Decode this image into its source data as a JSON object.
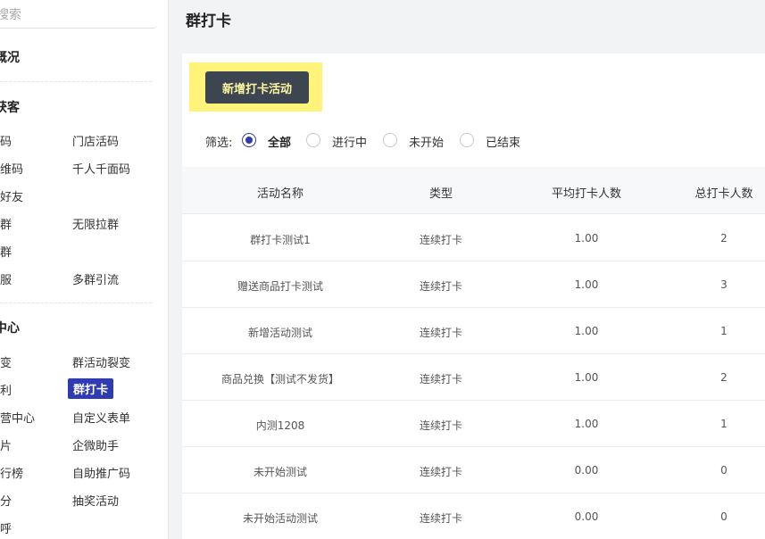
{
  "sidebar": {
    "search_placeholder": "搜索",
    "sections": [
      {
        "title": "概况"
      },
      {
        "title": "获客"
      },
      {
        "title": "中心"
      }
    ],
    "items": [
      {
        "label": "码"
      },
      {
        "label": "门店活码"
      },
      {
        "label": "维码"
      },
      {
        "label": "千人千面码"
      },
      {
        "label": "好友"
      },
      {
        "label": "群"
      },
      {
        "label": "无限拉群"
      },
      {
        "label": "群"
      },
      {
        "label": "服"
      },
      {
        "label": "多群引流"
      },
      {
        "label": "变"
      },
      {
        "label": "群活动裂变"
      },
      {
        "label": "利"
      },
      {
        "label": "群打卡"
      },
      {
        "label": "营中心"
      },
      {
        "label": "自定义表单"
      },
      {
        "label": "片"
      },
      {
        "label": "企微助手"
      },
      {
        "label": "行榜"
      },
      {
        "label": "自助推广码"
      },
      {
        "label": "分"
      },
      {
        "label": "抽奖活动"
      },
      {
        "label": "呼"
      }
    ]
  },
  "header": {
    "title": "群打卡"
  },
  "toolbar": {
    "add_label": "新增打卡活动"
  },
  "filter": {
    "label": "筛选:",
    "options": [
      "全部",
      "进行中",
      "未开始",
      "已结束"
    ],
    "selected": "全部"
  },
  "table": {
    "columns": [
      "活动名称",
      "类型",
      "平均打卡人数",
      "总打卡人数"
    ],
    "rows": [
      {
        "name": "群打卡测试1",
        "type": "连续打卡",
        "avg": "1.00",
        "total": "2"
      },
      {
        "name": "赠送商品打卡测试",
        "type": "连续打卡",
        "avg": "1.00",
        "total": "3"
      },
      {
        "name": "新增活动测试",
        "type": "连续打卡",
        "avg": "1.00",
        "total": "1"
      },
      {
        "name": "商品兑换【测试不发货】",
        "type": "连续打卡",
        "avg": "1.00",
        "total": "2"
      },
      {
        "name": "内测1208",
        "type": "连续打卡",
        "avg": "1.00",
        "total": "1"
      },
      {
        "name": "未开始测试",
        "type": "连续打卡",
        "avg": "0.00",
        "total": "0"
      },
      {
        "name": "未开始活动测试",
        "type": "连续打卡",
        "avg": "0.00",
        "total": "0"
      }
    ]
  },
  "colors": {
    "accent": "#2f3bb3",
    "button_bg": "#3c4550",
    "highlight": "#fff37a"
  }
}
